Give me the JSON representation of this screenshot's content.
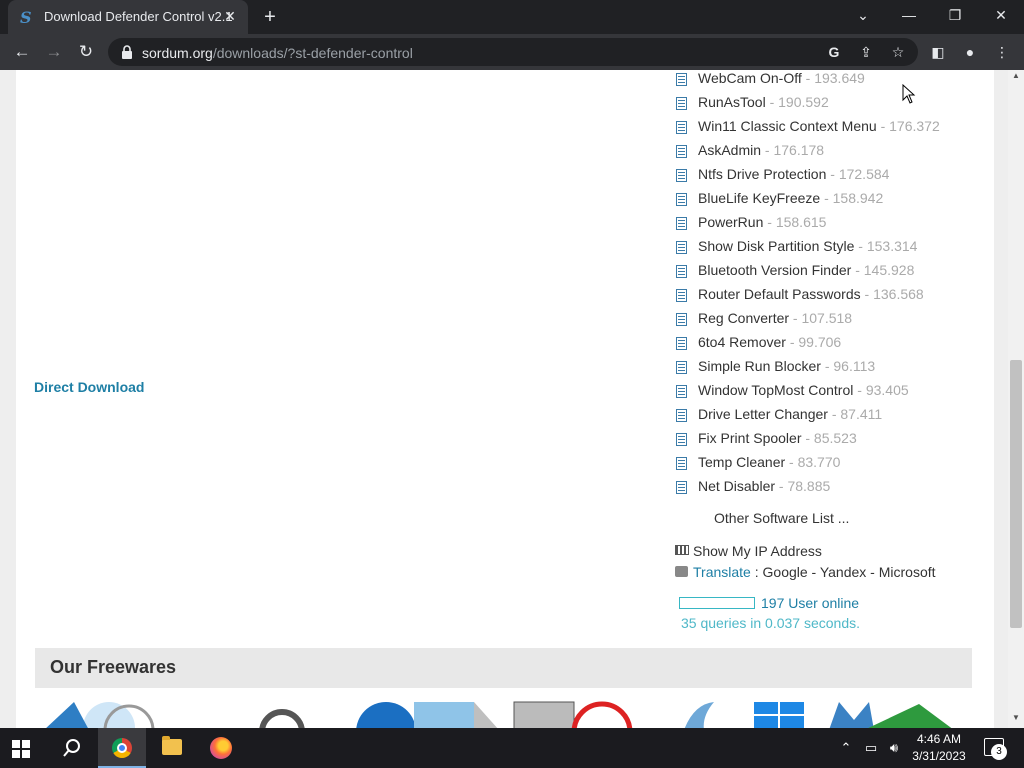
{
  "browser": {
    "tab_title": "Download Defender Control v2.1",
    "url_host": "sordum.org",
    "url_path": "/downloads/?st-defender-control"
  },
  "page": {
    "direct_download": "Direct Download",
    "software_list": [
      {
        "name": "WebCam On-Off",
        "count": " - 193.649"
      },
      {
        "name": "RunAsTool",
        "count": " - 190.592"
      },
      {
        "name": "Win11 Classic Context Menu",
        "count": " - 176.372"
      },
      {
        "name": "AskAdmin",
        "count": " - 176.178"
      },
      {
        "name": "Ntfs Drive Protection",
        "count": " - 172.584"
      },
      {
        "name": "BlueLife KeyFreeze",
        "count": " - 158.942"
      },
      {
        "name": "PowerRun",
        "count": " - 158.615"
      },
      {
        "name": "Show Disk Partition Style",
        "count": " - 153.314"
      },
      {
        "name": "Bluetooth Version Finder",
        "count": " - 145.928"
      },
      {
        "name": "Router Default Passwords",
        "count": " - 136.568"
      },
      {
        "name": "Reg Converter",
        "count": " - 107.518"
      },
      {
        "name": "6to4 Remover",
        "count": " - 99.706"
      },
      {
        "name": "Simple Run Blocker",
        "count": " - 96.113"
      },
      {
        "name": "Window TopMost Control",
        "count": " - 93.405"
      },
      {
        "name": "Drive Letter Changer",
        "count": " - 87.411"
      },
      {
        "name": "Fix Print Spooler",
        "count": " - 85.523"
      },
      {
        "name": "Temp Cleaner",
        "count": " - 83.770"
      },
      {
        "name": "Net Disabler",
        "count": " - 78.885"
      }
    ],
    "other_software": "Other Software List ...",
    "show_ip": "Show My IP Address",
    "translate_link": "Translate",
    "translate_rest": " : Google - Yandex - Microsoft",
    "online": "197 User online",
    "queries": "35 queries in 0.037 seconds.",
    "freewares_title": "Our Freewares"
  },
  "taskbar": {
    "time": "4:46 AM",
    "date": "3/31/2023",
    "notifications": "3"
  }
}
